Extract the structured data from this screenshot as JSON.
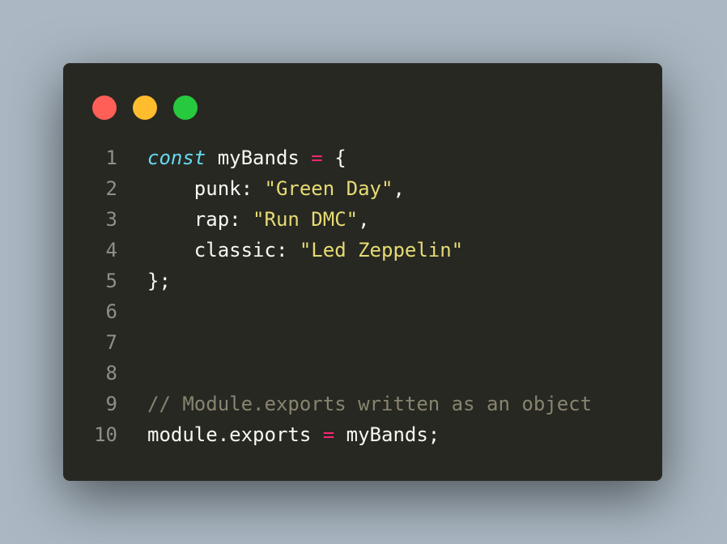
{
  "colors": {
    "background": "#abb8c3",
    "window": "#272822",
    "close_dot": "#ff5f56",
    "minimize_dot": "#ffbd2e",
    "zoom_dot": "#27c93f"
  },
  "window_controls": [
    "close",
    "minimize",
    "zoom"
  ],
  "code": {
    "lines": [
      {
        "number": "1",
        "tokens": [
          {
            "t": "kw",
            "v": "const"
          },
          {
            "t": "pl",
            "v": " myBands "
          },
          {
            "t": "op",
            "v": "="
          },
          {
            "t": "pl",
            "v": " {"
          }
        ]
      },
      {
        "number": "2",
        "tokens": [
          {
            "t": "pl",
            "v": "    punk: "
          },
          {
            "t": "str",
            "v": "\"Green Day\""
          },
          {
            "t": "pl",
            "v": ","
          }
        ]
      },
      {
        "number": "3",
        "tokens": [
          {
            "t": "pl",
            "v": "    rap: "
          },
          {
            "t": "str",
            "v": "\"Run DMC\""
          },
          {
            "t": "pl",
            "v": ","
          }
        ]
      },
      {
        "number": "4",
        "tokens": [
          {
            "t": "pl",
            "v": "    classic: "
          },
          {
            "t": "str",
            "v": "\"Led Zeppelin\""
          }
        ]
      },
      {
        "number": "5",
        "tokens": [
          {
            "t": "pl",
            "v": "};"
          }
        ]
      },
      {
        "number": "6",
        "tokens": []
      },
      {
        "number": "7",
        "tokens": []
      },
      {
        "number": "8",
        "tokens": []
      },
      {
        "number": "9",
        "tokens": [
          {
            "t": "cmt",
            "v": "// Module.exports written as an object"
          }
        ]
      },
      {
        "number": "10",
        "tokens": [
          {
            "t": "pl",
            "v": "module.exports "
          },
          {
            "t": "op",
            "v": "="
          },
          {
            "t": "pl",
            "v": " myBands;"
          }
        ]
      }
    ]
  }
}
